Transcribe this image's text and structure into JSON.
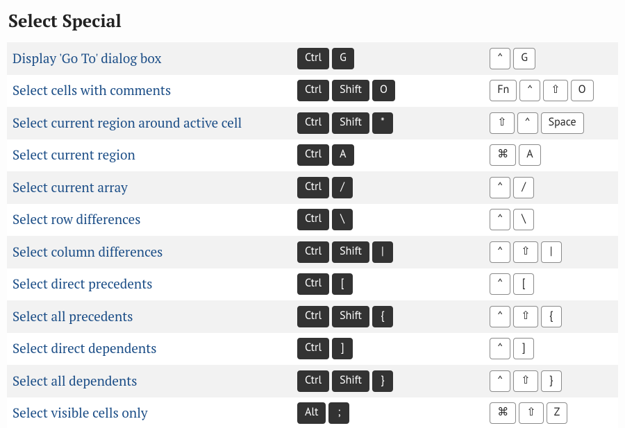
{
  "title": "Select Special",
  "rows": [
    {
      "desc": "Display 'Go To' dialog box",
      "win": [
        "Ctrl",
        "G"
      ],
      "mac": [
        "^",
        "G"
      ]
    },
    {
      "desc": "Select cells with comments",
      "win": [
        "Ctrl",
        "Shift",
        "O"
      ],
      "mac": [
        "Fn",
        "^",
        "⇧",
        "O"
      ]
    },
    {
      "desc": "Select current region around active cell",
      "win": [
        "Ctrl",
        "Shift",
        "*"
      ],
      "mac": [
        "⇧",
        "^",
        "Space"
      ]
    },
    {
      "desc": "Select current region",
      "win": [
        "Ctrl",
        "A"
      ],
      "mac": [
        "⌘",
        "A"
      ]
    },
    {
      "desc": "Select current array",
      "win": [
        "Ctrl",
        "/"
      ],
      "mac": [
        "^",
        "/"
      ]
    },
    {
      "desc": "Select row differences",
      "win": [
        "Ctrl",
        "\\"
      ],
      "mac": [
        "^",
        "\\"
      ]
    },
    {
      "desc": "Select column differences",
      "win": [
        "Ctrl",
        "Shift",
        "|"
      ],
      "mac": [
        "^",
        "⇧",
        "|"
      ]
    },
    {
      "desc": "Select direct precedents",
      "win": [
        "Ctrl",
        "["
      ],
      "mac": [
        "^",
        "["
      ]
    },
    {
      "desc": "Select all precedents",
      "win": [
        "Ctrl",
        "Shift",
        "{"
      ],
      "mac": [
        "^",
        "⇧",
        "{"
      ]
    },
    {
      "desc": "Select direct dependents",
      "win": [
        "Ctrl",
        "]"
      ],
      "mac": [
        "^",
        "]"
      ]
    },
    {
      "desc": "Select all dependents",
      "win": [
        "Ctrl",
        "Shift",
        "}"
      ],
      "mac": [
        "^",
        "⇧",
        "}"
      ]
    },
    {
      "desc": "Select visible cells only",
      "win": [
        "Alt",
        ";"
      ],
      "mac": [
        "⌘",
        "⇧",
        "Z"
      ]
    }
  ]
}
